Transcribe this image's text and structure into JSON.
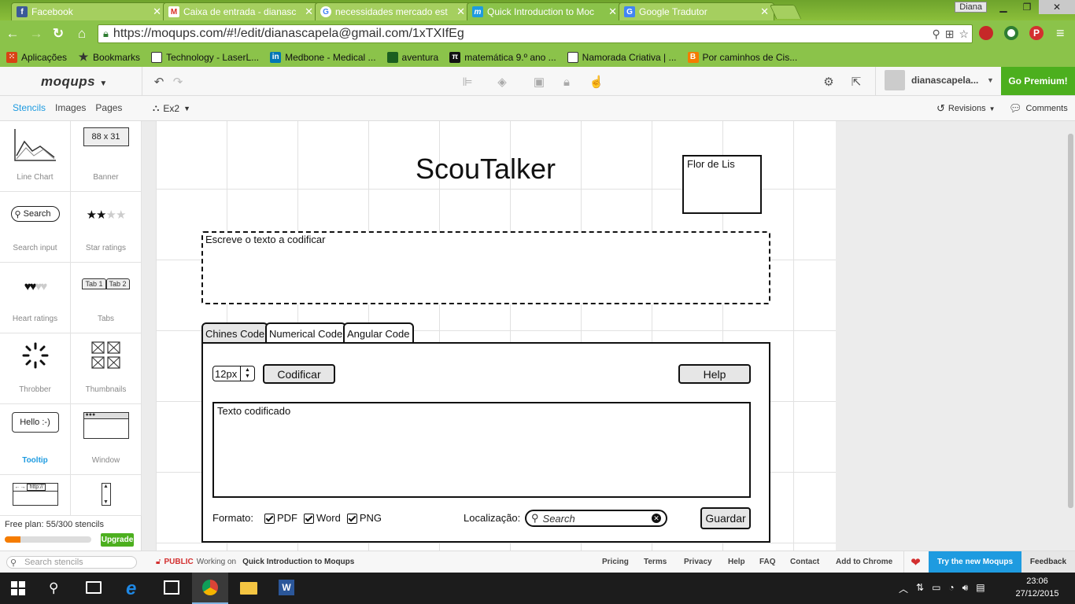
{
  "browser": {
    "tabs": [
      {
        "title": "Facebook",
        "icon": "facebook-icon",
        "color": "#3b5998"
      },
      {
        "title": "Caixa de entrada - dianasc",
        "icon": "gmail-icon",
        "color": "#d93025"
      },
      {
        "title": "necessidades mercado est",
        "icon": "google-icon",
        "color": "#4285f4"
      },
      {
        "title": "Quick Introduction to Moc",
        "icon": "moqups-icon",
        "color": "#1e9be0"
      },
      {
        "title": "Google Tradutor",
        "icon": "translate-icon",
        "color": "#4285f4"
      }
    ],
    "profile_name": "Diana",
    "url": "https://moqups.com/#!/edit/dianascapela@gmail.com/1xTXIfEg",
    "bookmarks": [
      {
        "label": "Aplicações",
        "icon": "apps-icon"
      },
      {
        "label": "Bookmarks",
        "icon": "star-icon"
      },
      {
        "label": "Technology - LaserL...",
        "icon": "page-icon"
      },
      {
        "label": "Medbone - Medical ...",
        "icon": "linkedin-icon"
      },
      {
        "label": "aventura",
        "icon": "image-icon"
      },
      {
        "label": "matemática 9.º ano ...",
        "icon": "pi-icon"
      },
      {
        "label": "Namorada Criativa | ...",
        "icon": "page-icon"
      },
      {
        "label": "Por caminhos de Cis...",
        "icon": "blogger-icon"
      }
    ]
  },
  "app": {
    "logo": "moqups",
    "page_name": "Ex2",
    "username": "dianascapela...",
    "premium_label": "Go Premium!",
    "revisions_label": "Revisions",
    "comments_label": "Comments"
  },
  "sidebar": {
    "tabs": [
      "Stencils",
      "Images",
      "Pages"
    ],
    "stencils": [
      {
        "label": "Line Chart",
        "icon": "line-chart-icon"
      },
      {
        "label": "Banner",
        "icon": "banner-icon",
        "text": "88 x 31"
      },
      {
        "label": "Search input",
        "icon": "search-input-icon",
        "text": "Search"
      },
      {
        "label": "Star ratings",
        "icon": "star-ratings-icon"
      },
      {
        "label": "Heart ratings",
        "icon": "heart-ratings-icon"
      },
      {
        "label": "Tabs",
        "icon": "tabs-icon",
        "text1": "Tab 1",
        "text2": "Tab 2"
      },
      {
        "label": "Throbber",
        "icon": "throbber-icon"
      },
      {
        "label": "Thumbnails",
        "icon": "thumbnails-icon"
      },
      {
        "label": "Tooltip",
        "icon": "tooltip-icon",
        "text": "Hello :-)"
      },
      {
        "label": "Window",
        "icon": "window-icon"
      }
    ],
    "browser_stencil_text": "http://",
    "plan_text": "Free plan: 55/300 stencils",
    "plan_fraction": 0.18,
    "upgrade_label": "Upgrade",
    "search_placeholder": "Search stencils"
  },
  "mockup": {
    "title": "ScouTalker",
    "logo_box_label": "Flor de Lis",
    "input_placeholder": "Escreve o texto a codificar",
    "tabs": [
      "Chines Code",
      "Numerical Code",
      "Angular Code"
    ],
    "font_size": "12px",
    "encode_button": "Codificar",
    "help_button": "Help",
    "output_text": "Texto codificado",
    "format_label": "Formato:",
    "formats": [
      "PDF",
      "Word",
      "PNG"
    ],
    "location_label": "Localização:",
    "search_placeholder": "Search",
    "save_button": "Guardar"
  },
  "statusbar": {
    "public_label": "PUBLIC",
    "working_on": "Working on",
    "project_name": "Quick Introduction to Moqups",
    "links": [
      "Pricing",
      "Terms",
      "Privacy",
      "Help",
      "FAQ",
      "Contact",
      "Add to Chrome"
    ],
    "try_label": "Try the new Moqups",
    "feedback_label": "Feedback"
  },
  "taskbar": {
    "time": "23:06",
    "date": "27/12/2015"
  },
  "colors": {
    "chrome_green": "#8bc34a",
    "premium_green": "#4caf1e",
    "accent_blue": "#1e9be0",
    "try_blue": "#1e9be0"
  }
}
